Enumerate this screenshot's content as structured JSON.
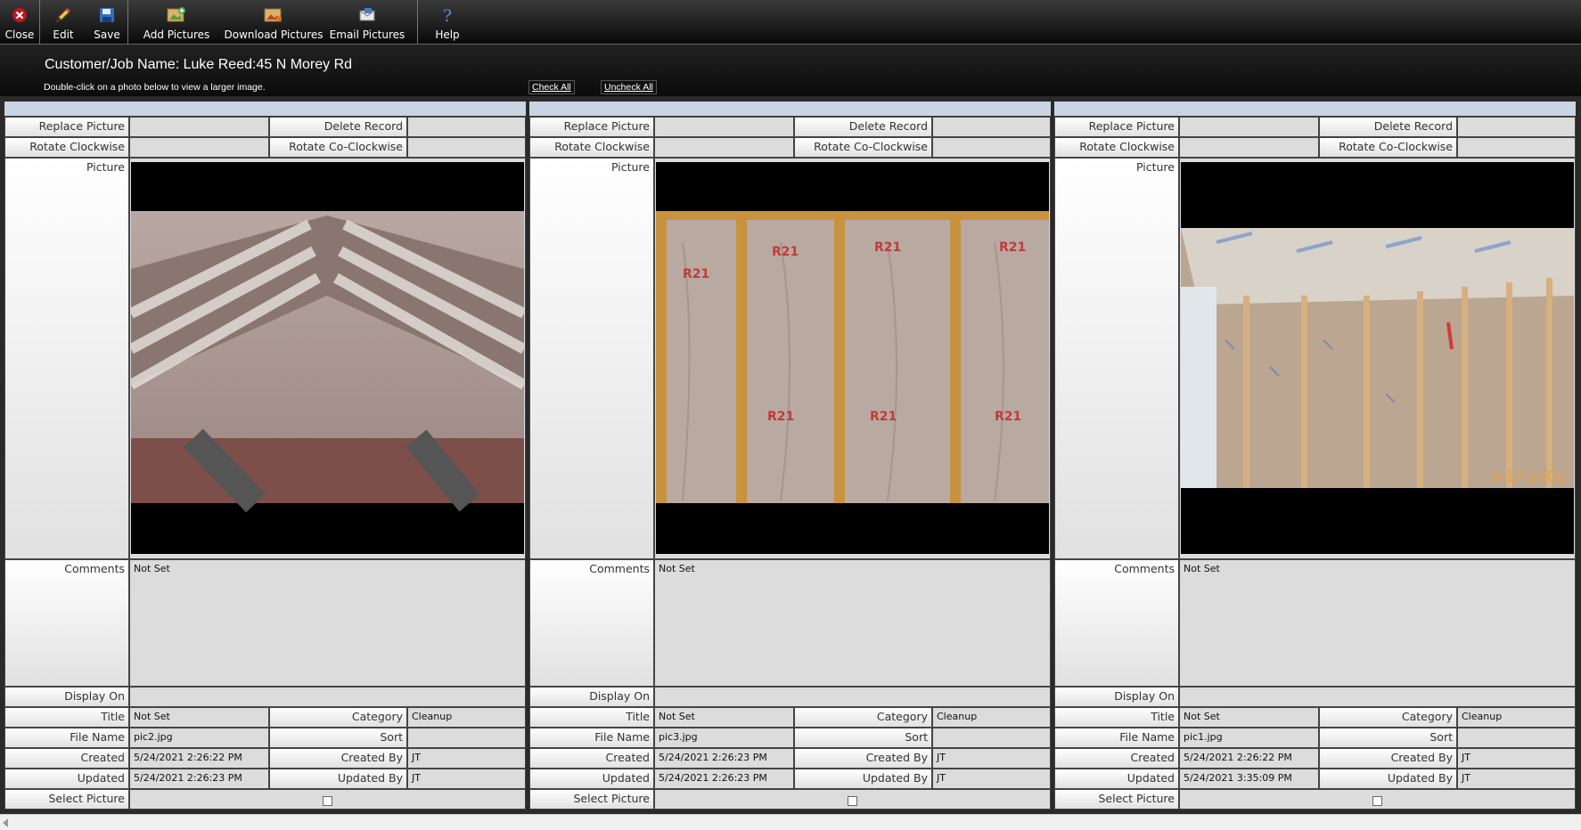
{
  "toolbar": {
    "close": "Close",
    "edit": "Edit",
    "save": "Save",
    "add_pictures": "Add Pictures",
    "download_pictures": "Download Pictures",
    "email_pictures": "Email Pictures",
    "help": "Help"
  },
  "header": {
    "job_title": "Customer/Job Name: Luke Reed:45 N Morey Rd",
    "hint": "Double-click on a photo below to view a larger image.",
    "check_all": "Check All",
    "uncheck_all": "Uncheck All"
  },
  "labels": {
    "replace_picture": "Replace Picture",
    "delete_record": "Delete Record",
    "rotate_clockwise": "Rotate Clockwise",
    "rotate_coclockwise": "Rotate Co-Clockwise",
    "picture": "Picture",
    "comments": "Comments",
    "display_on": "Display On",
    "title": "Title",
    "category": "Category",
    "file_name": "File Name",
    "sort": "Sort",
    "created": "Created",
    "created_by": "Created By",
    "updated": "Updated",
    "updated_by": "Updated By",
    "select_picture": "Select Picture"
  },
  "cards": [
    {
      "comments": "Not Set",
      "title": "Not Set",
      "category": "Cleanup",
      "file_name": "pic2.jpg",
      "sort": "",
      "created": "5/24/2021 2:26:22 PM",
      "created_by": "JT",
      "updated": "5/24/2021 2:26:23 PM",
      "updated_by": "JT"
    },
    {
      "comments": "Not Set",
      "title": "Not Set",
      "category": "Cleanup",
      "file_name": "pic3.jpg",
      "sort": "",
      "created": "5/24/2021 2:26:23 PM",
      "created_by": "JT",
      "updated": "5/24/2021 2:26:23 PM",
      "updated_by": "JT"
    },
    {
      "comments": "Not Set",
      "title": "Not Set",
      "category": "Cleanup",
      "file_name": "pic1.jpg",
      "sort": "",
      "created": "5/24/2021 2:26:22 PM",
      "created_by": "JT",
      "updated": "5/24/2021 3:35:09 PM",
      "updated_by": "JT",
      "photo_stamp": "9-17-2002"
    }
  ],
  "colors": {
    "card_header": "#c9d5e3",
    "value_bg": "#dcdcdc",
    "close_red": "#c0141c",
    "toolbar_dark": "#0a0a0a"
  }
}
